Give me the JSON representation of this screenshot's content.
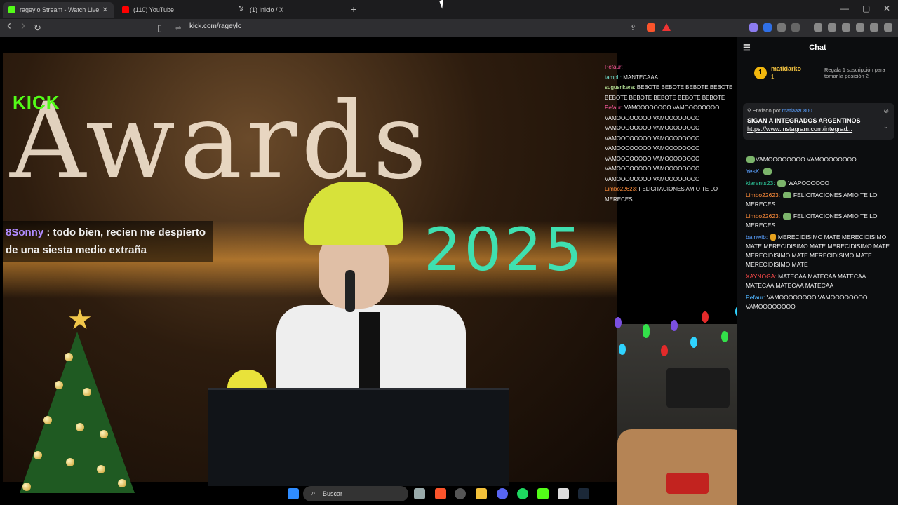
{
  "tabs": [
    {
      "label": "rageylo Stream - Watch Live o",
      "close": "✕",
      "color": "#53fc18"
    },
    {
      "label": "(110) YouTube",
      "color": "#ff0000"
    },
    {
      "label": "(1) Inicio / X",
      "color": "#ffffff"
    }
  ],
  "newtab": "+",
  "window_controls": {
    "min": "—",
    "max": "▢",
    "close": "✕"
  },
  "toolbar": {
    "back": "‹",
    "forward": "›",
    "reload": "↻",
    "bookmark": "▯",
    "site_info": "⇌",
    "url": "kick.com/rageylo",
    "share": "⇪"
  },
  "stream": {
    "kick_logo": "KICK",
    "awards_text": "Awards",
    "year_text": "2025",
    "caption_user": "8Sonny",
    "caption_text": " : todo bien, recien me despierto de una siesta medio extraña",
    "overlay_chat": [
      {
        "user": "Pefaur:",
        "text": ""
      },
      {
        "user": "tamplt:",
        "text": " MANTECAAA"
      },
      {
        "user": "sugusrikera:",
        "text": " BEBOTE BEBOTE BEBOTE BEBOTE BEBOTE BEBOTE BEBOTE BEBOTE BEBOTE"
      },
      {
        "user": "Pefaur:",
        "text": " VAMOOOOOOOO VAMOOOOOOOO VAMOOOOOOOO VAMOOOOOOOO VAMOOOOOOOO VAMOOOOOOOO VAMOOOOOOOO VAMOOOOOOOO VAMOOOOOOOO VAMOOOOOOOO VAMOOOOOOOO VAMOOOOOOOO VAMOOOOOOOO VAMOOOOOOOO VAMOOOOOOOO VAMOOOOOOOO"
      },
      {
        "user": "Limbo22623:",
        "text": " FELICITACIONES AMIO TE LO MERECES"
      }
    ]
  },
  "chat": {
    "title": "Chat",
    "leader": {
      "rank": "1",
      "name": "matidarko",
      "count": "1",
      "gift_text": "Regala 1 suscripción para tomar la posición 2"
    },
    "pinned": {
      "sent_by": "Enviado por",
      "sender": "matiaaz0800",
      "title": "SIGAN A INTEGRADOS ARGENTINOS",
      "link": "https://www.instagram.com/integrad..."
    },
    "messages": [
      {
        "user": "",
        "text": "VAMOOOOOOOO VAMOOOOOOOO",
        "cls": ""
      },
      {
        "user": "YesK:",
        "text": "",
        "cls": "u-blue"
      },
      {
        "user": "kiarents23:",
        "text": " WAPOOOOOO",
        "cls": "u-green"
      },
      {
        "user": "Limbo22623:",
        "text": " FELICITACIONES AMIO TE LO MERECES",
        "cls": "u-orange"
      },
      {
        "user": "Limbo22623:",
        "text": " FELICITACIONES AMIO TE LO MERECES",
        "cls": "u-orange"
      },
      {
        "user": "bainwib:",
        "text": " MERECIDISIMO MATE MERECIDISIMO MATE MERECIDISIMO MATE MERECIDISIMO MATE MERECIDISIMO MATE MERECIDISIMO MATE MERECIDISIMO MATE",
        "cls": "u-blue"
      },
      {
        "user": "XAYNOGA:",
        "text": " MATECAA MATECAA MATECAA MATECAA MATECAA MATECAA",
        "cls": "u-red"
      },
      {
        "user": "Pefaur:",
        "text": " VAMOOOOOOOO VAMOOOOOOOO VAMOOOOOOOO",
        "cls": "u-cyan"
      }
    ]
  },
  "taskbar": {
    "search_placeholder": "Buscar",
    "search_icon": "⌕"
  },
  "colors": {
    "kick_green": "#53fc18",
    "chat_bg": "#0c0d0f",
    "gold": "#f2b70d"
  }
}
